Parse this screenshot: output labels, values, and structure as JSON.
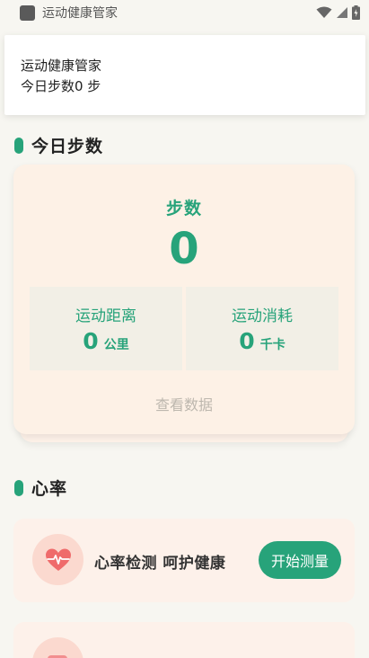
{
  "status_bar": {
    "app_title": "运动健康管家",
    "icons": [
      "app-icon",
      "wifi-icon",
      "signal-icon",
      "battery-icon"
    ]
  },
  "notification": {
    "title": "运动健康管家",
    "body": "今日步数0 步"
  },
  "steps_section": {
    "title": "今日步数",
    "card": {
      "steps_label": "步数",
      "steps_value": "0",
      "distance": {
        "label": "运动距离",
        "value": "0",
        "unit": "公里"
      },
      "calories": {
        "label": "运动消耗",
        "value": "0",
        "unit": "千卡"
      },
      "view_data_label": "查看数据"
    }
  },
  "heart_section": {
    "title": "心率",
    "card": {
      "icon": "heart-rate-icon",
      "text": "心率检测 呵护健康",
      "button_label": "开始测量"
    }
  },
  "colors": {
    "accent": "#27a37a",
    "card_bg": "#fdf1e6",
    "metric_bg": "#f2efe6",
    "heart_circle": "#fbd9cf",
    "heart_red": "#ef6b6b"
  }
}
